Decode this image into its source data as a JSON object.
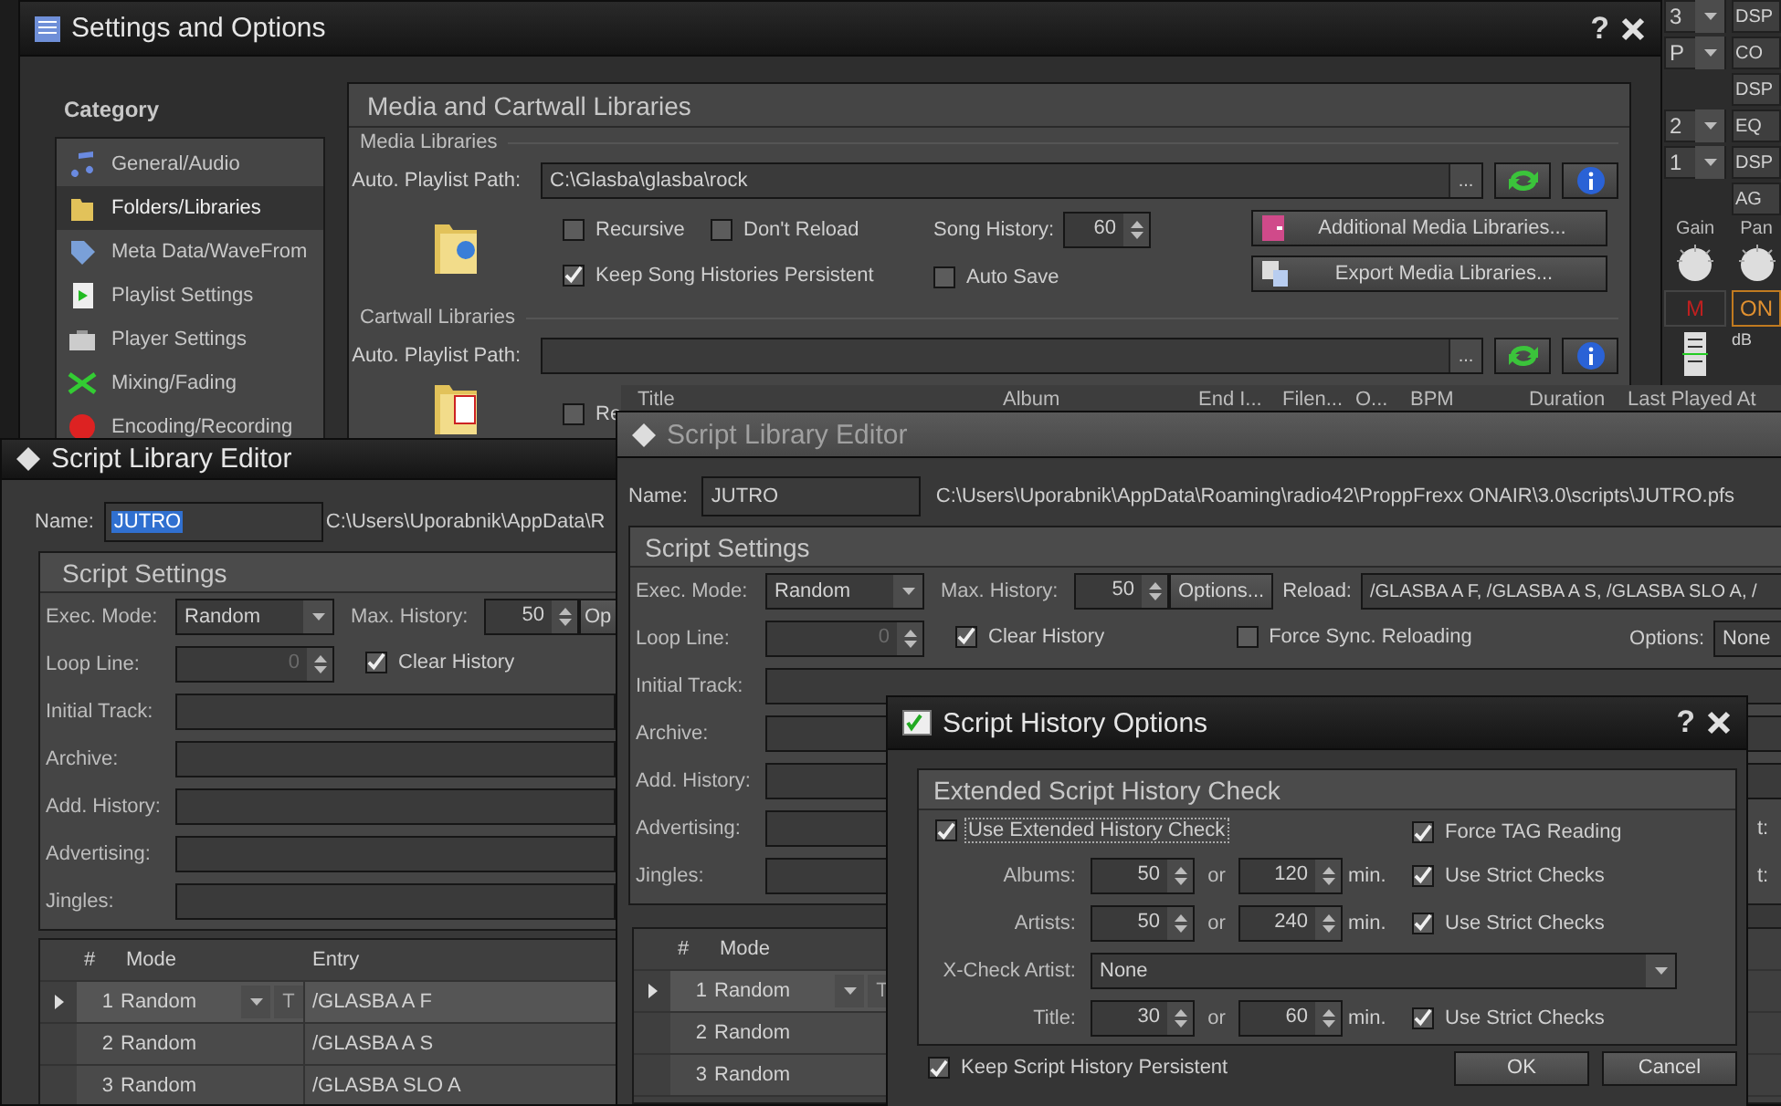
{
  "mixer": {
    "selectors": [
      "3",
      "P",
      "2",
      "1"
    ],
    "effects": [
      "DSP",
      "CO",
      "DSP",
      "EQ",
      "DSP",
      "AG"
    ],
    "knobs": [
      "Gain",
      "Pan"
    ],
    "mute": "M",
    "on": "ON",
    "meter_label": "dB"
  },
  "library_columns": [
    "Title",
    "Album",
    "End I...",
    "Filen...",
    "O...",
    "BPM",
    "Duration",
    "Last Played At"
  ],
  "settings": {
    "title": "Settings and Options",
    "help": "?",
    "category": {
      "heading": "Category",
      "items": [
        {
          "label": "General/Audio",
          "selected": false
        },
        {
          "label": "Folders/Libraries",
          "selected": true
        },
        {
          "label": "Meta Data/WaveFrom",
          "selected": false
        },
        {
          "label": "Playlist Settings",
          "selected": false
        },
        {
          "label": "Player Settings",
          "selected": false
        },
        {
          "label": "Mixing/Fading",
          "selected": false
        },
        {
          "label": "Encoding/Recording",
          "selected": false
        }
      ]
    },
    "panel": {
      "title": "Media and Cartwall Libraries",
      "media": {
        "heading": "Media Libraries",
        "path_label": "Auto. Playlist Path:",
        "path": "C:\\Glasba\\glasba\\rock",
        "browse": "...",
        "recursive": {
          "label": "Recursive",
          "checked": false
        },
        "dont_reload": {
          "label": "Don't Reload",
          "checked": false
        },
        "song_history_label": "Song History:",
        "song_history": "60",
        "keep_persistent": {
          "label": "Keep Song Histories Persistent",
          "checked": true
        },
        "auto_save": {
          "label": "Auto Save",
          "checked": false
        },
        "buttons": [
          "Additional Media Libraries...",
          "Export Media Libraries..."
        ]
      },
      "cartwall": {
        "heading": "Cartwall Libraries",
        "path_label": "Auto. Playlist Path:",
        "browse": "...",
        "recursive": {
          "label": "Re",
          "checked": false
        }
      }
    }
  },
  "editor_back": {
    "title": "Script Library Editor",
    "name_label": "Name:",
    "name": {
      "value": "JUTRO",
      "selected": true
    },
    "path": "C:\\Users\\Uporabnik\\AppData\\R",
    "settings": {
      "title": "Script Settings",
      "exec_mode_label": "Exec. Mode:",
      "exec_mode": "Random",
      "max_history_label": "Max. History:",
      "max_history": "50",
      "options_button": "Op",
      "loop_line_label": "Loop Line:",
      "loop_line": "0",
      "loop_line_disabled": true,
      "clear_history": {
        "label": "Clear History",
        "checked": true
      },
      "fields": [
        {
          "label": "Initial Track:"
        },
        {
          "label": "Archive:"
        },
        {
          "label": "Add. History:"
        },
        {
          "label": "Advertising:"
        },
        {
          "label": "Jingles:"
        }
      ]
    },
    "grid": {
      "columns": [
        "#",
        "Mode",
        "Entry"
      ],
      "rows": [
        {
          "number": "1",
          "mode": "Random",
          "entry": "/GLASBA A F",
          "toggle": "T",
          "selected": true
        },
        {
          "number": "2",
          "mode": "Random",
          "entry": "/GLASBA A S",
          "selected": false
        },
        {
          "number": "3",
          "mode": "Random",
          "entry": "/GLASBA SLO A",
          "selected": false
        }
      ]
    }
  },
  "editor_front": {
    "title": "Script Library Editor",
    "name_label": "Name:",
    "name": {
      "value": "JUTRO",
      "selected": false
    },
    "path": "C:\\Users\\Uporabnik\\AppData\\Roaming\\radio42\\ProppFrexx ONAIR\\3.0\\scripts\\JUTRO.pfs",
    "settings": {
      "title": "Script Settings",
      "exec_mode_label": "Exec. Mode:",
      "exec_mode": "Random",
      "max_history_label": "Max. History:",
      "max_history": "50",
      "options_button": "Options...",
      "reload_label": "Reload:",
      "reload": "/GLASBA A F, /GLASBA A S, /GLASBA SLO A, /",
      "loop_line_label": "Loop Line:",
      "loop_line": "0",
      "loop_line_disabled": true,
      "clear_history": {
        "label": "Clear History",
        "checked": true
      },
      "force_sync": {
        "label": "Force Sync. Reloading",
        "checked": false
      },
      "options_label": "Options:",
      "options_value": "None",
      "fields": [
        {
          "label": "Initial Track:"
        },
        {
          "label": "Archive:"
        },
        {
          "label": "Add. History:"
        },
        {
          "label": "Advertising:",
          "trailing": "t:"
        },
        {
          "label": "Jingles:",
          "trailing": "t:"
        }
      ]
    },
    "grid": {
      "columns": [
        "#",
        "Mode"
      ],
      "rows": [
        {
          "number": "1",
          "mode": "Random",
          "toggle": "T",
          "selected": true
        },
        {
          "number": "2",
          "mode": "Random",
          "selected": false
        },
        {
          "number": "3",
          "mode": "Random",
          "selected": false
        }
      ]
    }
  },
  "history": {
    "title": "Script History Options",
    "help": "?",
    "group": {
      "title": "Extended Script History Check",
      "use_extended": {
        "label": "Use Extended History Check",
        "checked": true,
        "focused": true
      },
      "force_tag": {
        "label": "Force TAG Reading",
        "checked": true
      },
      "rows": [
        {
          "kind": "range",
          "label": "Albums:",
          "value": "50",
          "or": "or",
          "max": "120",
          "unit": "min.",
          "strict": {
            "label": "Use Strict Checks",
            "checked": true
          }
        },
        {
          "kind": "range",
          "label": "Artists:",
          "value": "50",
          "or": "or",
          "max": "240",
          "unit": "min.",
          "strict": {
            "label": "Use Strict Checks",
            "checked": true
          }
        },
        {
          "kind": "select",
          "label": "X-Check Artist:",
          "value": "None"
        },
        {
          "kind": "range",
          "label": "Title:",
          "value": "30",
          "or": "or",
          "max": "60",
          "unit": "min.",
          "strict": {
            "label": "Use Strict Checks",
            "checked": true
          }
        }
      ]
    },
    "keep_persistent": {
      "label": "Keep Script History Persistent",
      "checked": true
    },
    "buttons": [
      "OK",
      "Cancel"
    ]
  }
}
